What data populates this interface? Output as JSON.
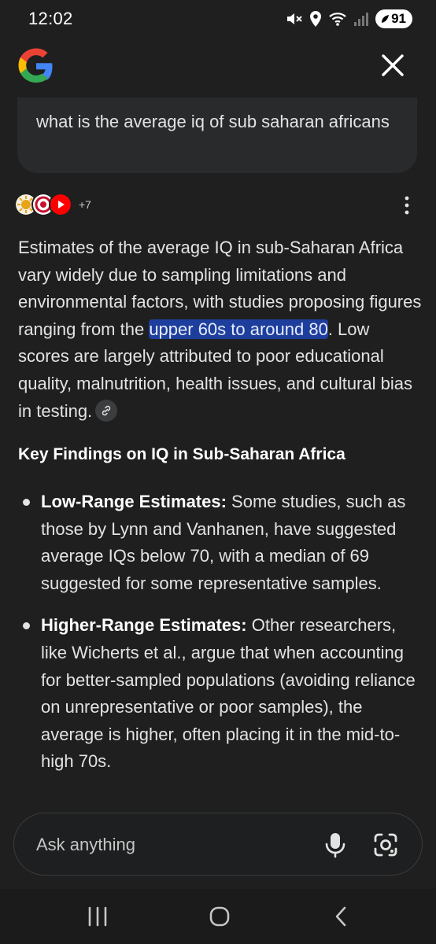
{
  "status_bar": {
    "time": "12:02",
    "battery": "91",
    "icons": [
      "mute-icon",
      "location-icon",
      "wifi-icon",
      "signal-icon",
      "battery-icon"
    ]
  },
  "header": {
    "logo": "google-g-logo",
    "close_icon": "close-icon"
  },
  "query": {
    "text": "what is the average iq of sub saharan africans"
  },
  "sources": {
    "favicons": [
      "source-favicon-1",
      "source-favicon-2",
      "source-favicon-3"
    ],
    "more_count": "+7"
  },
  "answer": {
    "intro_before": "Estimates of the average IQ in sub-Saharan Africa vary widely due to sampling limitations and environmental factors, with studies proposing figures ranging from the ",
    "intro_highlight": "upper 60s to around 80",
    "intro_after": ". Low scores are largely attributed to poor educational quality, malnutrition, health issues, and cultural bias in testing.",
    "heading": "Key Findings on IQ in Sub-Saharan Africa",
    "bullets": [
      {
        "title": "Low-Range Estimates:",
        "text": " Some studies, such as those by Lynn and Vanhanen, have suggested average IQs below 70, with a median of 69 suggested for some representative samples."
      },
      {
        "title": "Higher-Range Estimates:",
        "text": " Other researchers, like Wicherts et al., argue that when accounting for better-sampled populations (avoiding reliance on unrepresentative or poor samples), the average is higher, often placing it in the mid-to-high 70s."
      }
    ]
  },
  "ask_bar": {
    "placeholder": "Ask anything"
  },
  "colors": {
    "background": "#1f1f1f",
    "highlight": "#1d3e9c",
    "text": "#e3e3e3"
  }
}
